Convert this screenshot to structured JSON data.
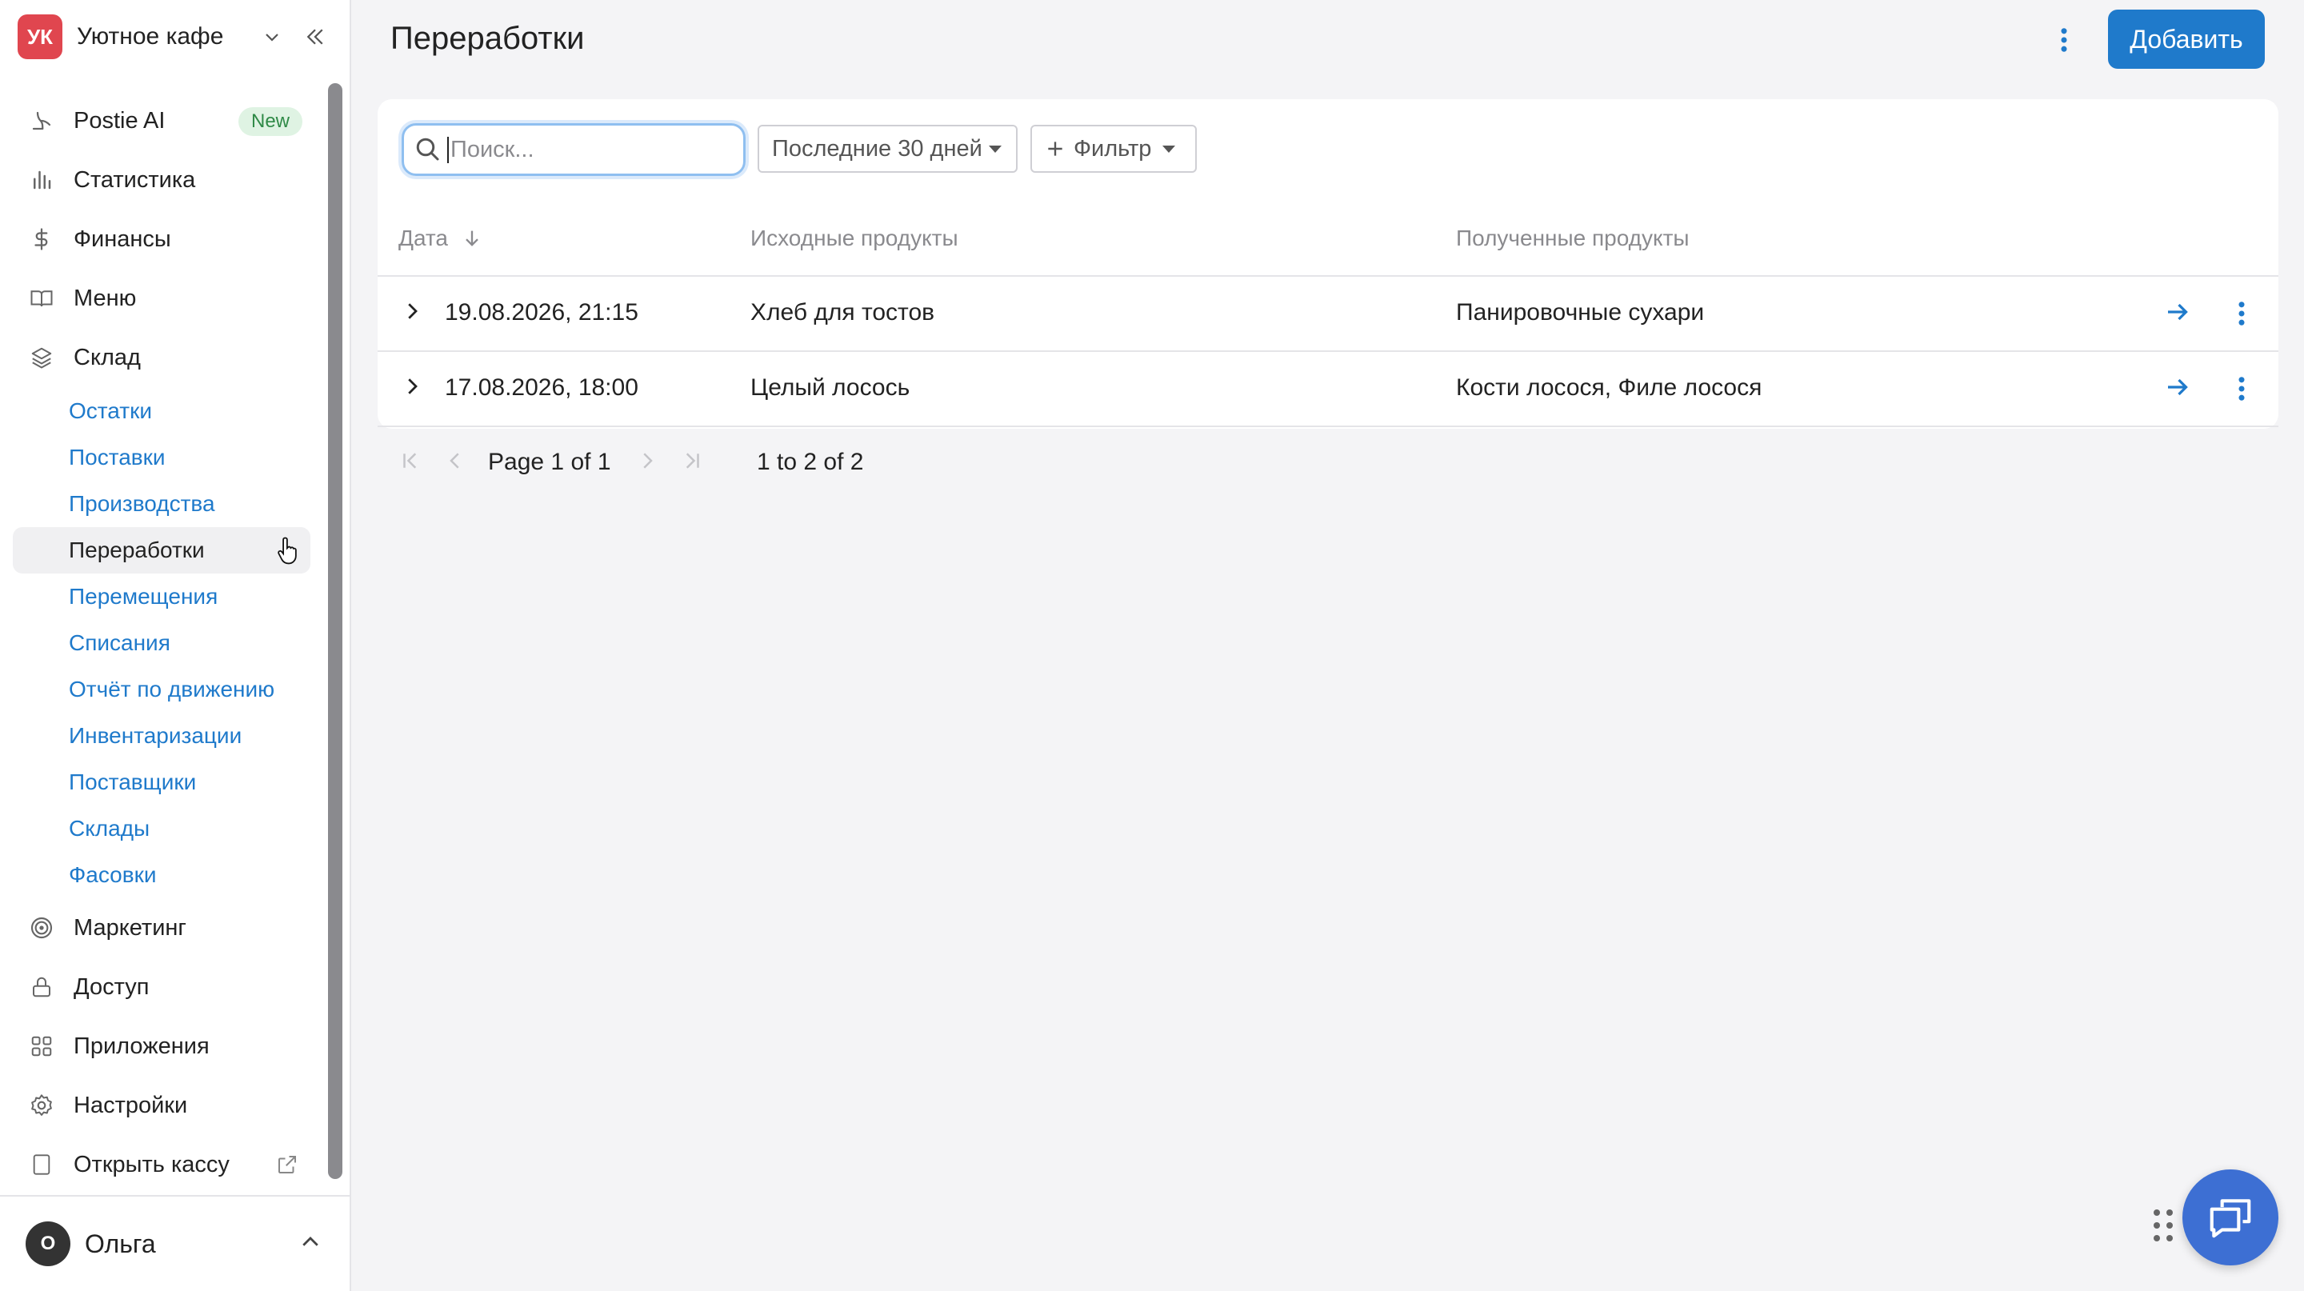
{
  "brand": {
    "initials": "УК",
    "name": "Уютное кафе"
  },
  "sidebar": {
    "items": [
      {
        "label": "Postie AI",
        "icon": "postie-icon",
        "badge": "New"
      },
      {
        "label": "Статистика",
        "icon": "bar-chart-icon"
      },
      {
        "label": "Финансы",
        "icon": "dollar-icon"
      },
      {
        "label": "Меню",
        "icon": "book-icon"
      },
      {
        "label": "Склад",
        "icon": "layers-icon"
      },
      {
        "label": "Маркетинг",
        "icon": "target-icon"
      },
      {
        "label": "Доступ",
        "icon": "lock-icon"
      },
      {
        "label": "Приложения",
        "icon": "grid-icon"
      },
      {
        "label": "Настройки",
        "icon": "gear-icon"
      },
      {
        "label": "Открыть кассу",
        "icon": "tablet-icon"
      }
    ],
    "sub_items": [
      "Остатки",
      "Поставки",
      "Производства",
      "Переработки",
      "Перемещения",
      "Списания",
      "Отчёт по движению",
      "Инвентаризации",
      "Поставщики",
      "Склады",
      "Фасовки"
    ],
    "active_sub": "Переработки"
  },
  "user": {
    "initial": "О",
    "name": "Ольга"
  },
  "page": {
    "title": "Переработки",
    "add_label": "Добавить"
  },
  "toolbar": {
    "search_placeholder": "Поиск...",
    "period": "Последние 30 дней",
    "filter": "Фильтр"
  },
  "table": {
    "headers": {
      "date": "Дата",
      "source": "Исходные продукты",
      "result": "Полученные продукты"
    },
    "rows": [
      {
        "date": "19.08.2026, 21:15",
        "source": "Хлеб для тостов",
        "result": "Панировочные сухари"
      },
      {
        "date": "17.08.2026, 18:00",
        "source": "Целый лосось",
        "result": "Кости лосося, Филе лосося"
      }
    ]
  },
  "pager": {
    "page_prefix": "Page",
    "page": "1",
    "of_word": "of",
    "total_pages": "1",
    "range": "1 to 2 of 2"
  },
  "colors": {
    "accent": "#1f7acb",
    "brand_badge": "#e0464f",
    "chat": "#3d6fd3",
    "new_badge_bg": "#dff3e3"
  }
}
